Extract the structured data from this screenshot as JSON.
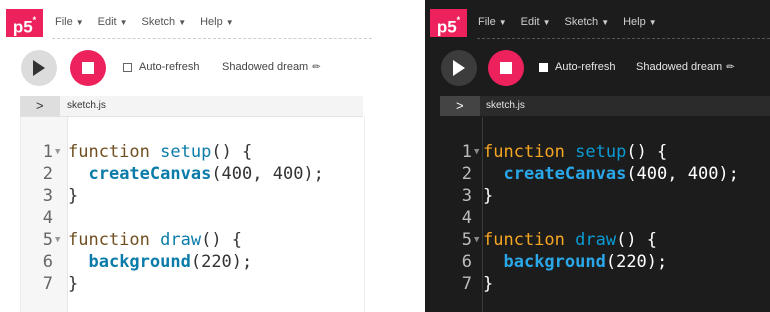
{
  "logo": {
    "text": "p5",
    "sup": "*"
  },
  "menu": [
    {
      "label": "File"
    },
    {
      "label": "Edit"
    },
    {
      "label": "Sketch"
    },
    {
      "label": "Help"
    }
  ],
  "toolbar": {
    "auto_refresh_label": "Auto-refresh",
    "sketch_name": "Shadowed dream"
  },
  "file": {
    "name": "sketch.js",
    "expand_glyph": ">"
  },
  "code": {
    "lines": [
      {
        "n": "1",
        "kw": "function",
        "name": "setup",
        "rest": "() {"
      },
      {
        "n": "2",
        "call": "createCanvas",
        "rest": "(400, 400);"
      },
      {
        "n": "3",
        "text": "}"
      },
      {
        "n": "4",
        "text": ""
      },
      {
        "n": "5",
        "kw": "function",
        "name": "draw",
        "rest": "() {"
      },
      {
        "n": "6",
        "call": "background",
        "rest": "(220);"
      },
      {
        "n": "7",
        "text": "}"
      }
    ]
  },
  "icons": [
    "play-icon",
    "stop-icon",
    "pencil-icon",
    "chevron-down-icon",
    "chevron-right-icon",
    "fold-arrow-icon"
  ],
  "colors": {
    "brand": "#ed225d",
    "dark_bg": "#1c1c1c",
    "light_bg": "#ffffff"
  }
}
